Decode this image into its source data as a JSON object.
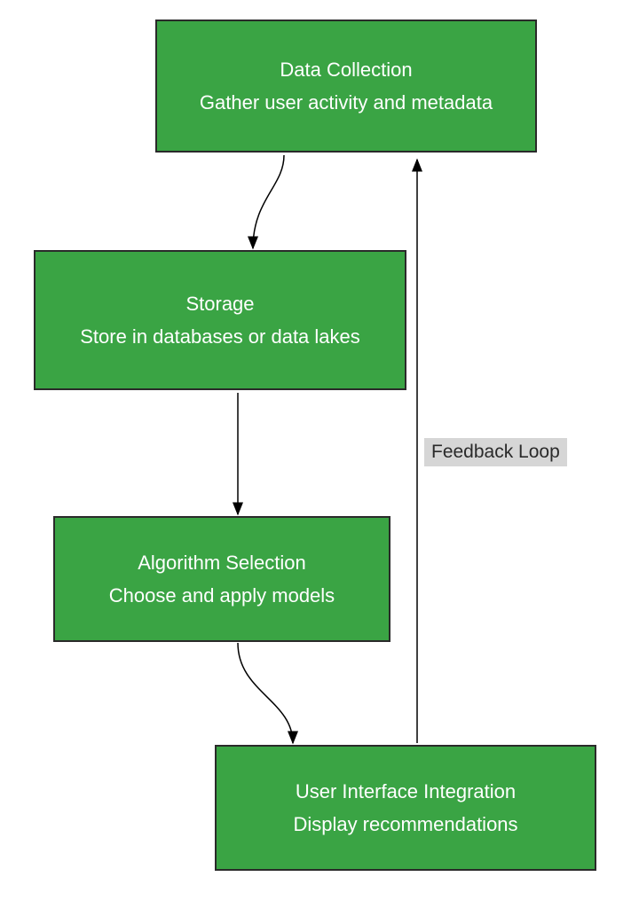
{
  "nodes": {
    "data_collection": {
      "title": "Data Collection",
      "desc": "Gather user activity and metadata"
    },
    "storage": {
      "title": "Storage",
      "desc": "Store in databases or data lakes"
    },
    "algorithm": {
      "title": "Algorithm Selection",
      "desc": "Choose and apply models"
    },
    "ui_integration": {
      "title": "User Interface Integration",
      "desc": "Display recommendations"
    }
  },
  "edges": {
    "feedback": "Feedback Loop"
  },
  "chart_data": {
    "type": "flowchart",
    "nodes": [
      {
        "id": "data_collection",
        "title": "Data Collection",
        "desc": "Gather user activity and metadata"
      },
      {
        "id": "storage",
        "title": "Storage",
        "desc": "Store in databases or data lakes"
      },
      {
        "id": "algorithm",
        "title": "Algorithm Selection",
        "desc": "Choose and apply models"
      },
      {
        "id": "ui_integration",
        "title": "User Interface Integration",
        "desc": "Display recommendations"
      }
    ],
    "edges": [
      {
        "from": "data_collection",
        "to": "storage"
      },
      {
        "from": "storage",
        "to": "algorithm"
      },
      {
        "from": "algorithm",
        "to": "ui_integration"
      },
      {
        "from": "ui_integration",
        "to": "data_collection",
        "label": "Feedback Loop"
      }
    ]
  }
}
